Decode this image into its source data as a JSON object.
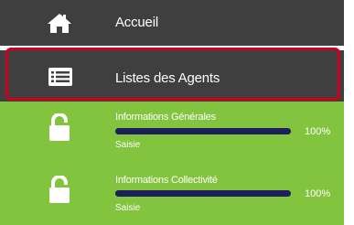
{
  "menu": {
    "home": {
      "label": "Accueil",
      "icon": "home-icon"
    },
    "agents_list": {
      "label": "Listes des Agents",
      "icon": "list-icon"
    },
    "progress_items": [
      {
        "title": "Informations Générales",
        "progress": 100,
        "percent_label": "100%",
        "status": "Saisie",
        "icon": "unlock-icon"
      },
      {
        "title": "Informations Collectivité",
        "progress": 100,
        "percent_label": "100%",
        "status": "Saisie",
        "icon": "unlock-icon"
      }
    ]
  },
  "colors": {
    "dark_row": "#3f3f3f",
    "green_row": "#83c43f",
    "selected_outline": "#cc0022",
    "progress_fill": "#1e1f5a",
    "text": "#ffffff"
  }
}
